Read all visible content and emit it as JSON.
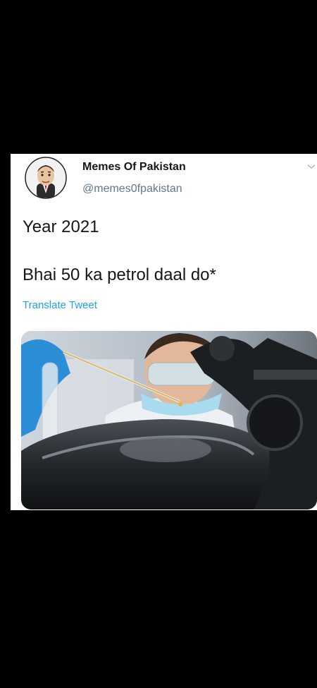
{
  "tweet": {
    "display_name": "Memes Of Pakistan",
    "handle": "@memes0fpakistan",
    "text_lines": [
      "Year 2021",
      "Bhai 50 ka petrol daal do*"
    ],
    "translate_label": "Translate Tweet",
    "avatar_icon": "mr-bean-avatar",
    "menu_icon": "chevron-down-icon",
    "media_description_icon": "scientist-dropping-fuel-into-motorcycle-tank-image"
  },
  "colors": {
    "background": "#000000",
    "card": "#ffffff",
    "name": "#14171a",
    "handle": "#657786",
    "link": "#1da1f2"
  }
}
